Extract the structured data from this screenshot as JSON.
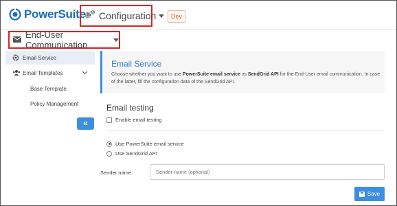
{
  "app": {
    "name": "PowerSuite",
    "tm": "™"
  },
  "header": {
    "module_label": "Configuration",
    "environment": "Dev"
  },
  "section": {
    "label": "End-User Communication"
  },
  "sidebar": {
    "items": [
      {
        "label": "Email Service",
        "active": true,
        "icon": "gear-icon"
      },
      {
        "label": "Email Templates",
        "expandable": true,
        "icon": "users-icon"
      },
      {
        "label": "Base Template"
      },
      {
        "label": "Policy Management"
      }
    ],
    "collapse_symbol": "«"
  },
  "info": {
    "title": "Email Service",
    "desc_part1": "Choose whether you want to use ",
    "desc_bold1": "PowerSuite email service",
    "desc_part2": " vs ",
    "desc_bold2": "SendGrid API",
    "desc_part3": " for the End-User email communication. In case of the latter, fill the configuration data of the SendGrid API."
  },
  "email_testing": {
    "title": "Email testing",
    "checkbox_label": "Enable email testing",
    "checked": false
  },
  "provider": {
    "options": [
      {
        "label": "Use PowerSuite email service",
        "selected": true
      },
      {
        "label": "Use SendGrid API",
        "selected": false
      }
    ]
  },
  "sender": {
    "label": "Sender name",
    "placeholder": "Sender name (optional)",
    "value": ""
  },
  "actions": {
    "save_label": "Save"
  },
  "colors": {
    "accent": "#3c8ee0",
    "brand": "#1a6fb5",
    "highlight": "#e02020",
    "env_badge": "#e05a1a"
  }
}
